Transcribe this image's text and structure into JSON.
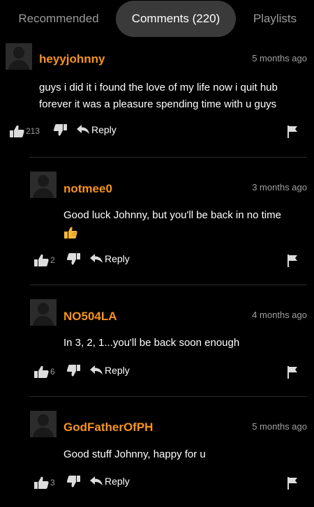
{
  "tabs": [
    {
      "label": "Recommended"
    },
    {
      "label": "Comments (220)"
    },
    {
      "label": "Playlists"
    }
  ],
  "colors": {
    "accent": "#f7931e",
    "active_tab_bg": "#3a3a3a",
    "emoji": "#f6b73c"
  },
  "icons": [
    "thumbs-up-icon",
    "thumbs-down-icon",
    "reply-arrow-icon",
    "flag-icon",
    "thumbs-up-emoji"
  ],
  "comments": [
    {
      "user": "heyyjohnny",
      "time": "5 months ago",
      "text_lines": [
        "guys i did it i found the love of my life now i quit hub",
        "forever it was a pleasure spending time with u guys"
      ],
      "likes": "213",
      "reply_label": "Reply"
    },
    {
      "user": "notmee0",
      "time": "3 months ago",
      "text_lines": [
        "Good luck Johnny, but you'll be back in no time"
      ],
      "likes": "2",
      "reply_label": "Reply"
    },
    {
      "user": "NO504LA",
      "time": "4 months ago",
      "text_lines": [
        "In 3, 2, 1...you'll be back soon enough"
      ],
      "likes": "6",
      "reply_label": "Reply"
    },
    {
      "user": "GodFatherOfPH",
      "time": "5 months ago",
      "text_lines": [
        "Good stuff Johnny, happy for u"
      ],
      "likes": "3",
      "reply_label": "Reply"
    }
  ]
}
